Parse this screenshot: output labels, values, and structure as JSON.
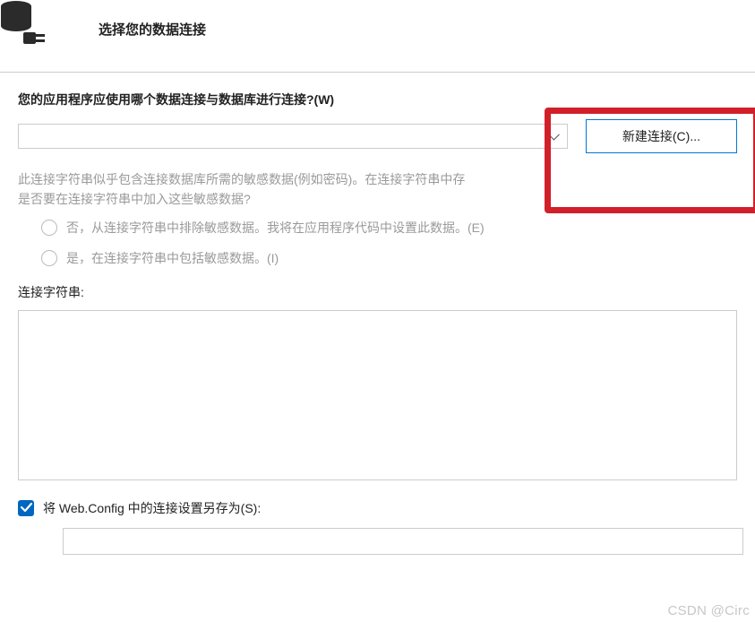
{
  "header": {
    "title": "选择您的数据连接"
  },
  "connection": {
    "question_label": "您的应用程序应使用哪个数据连接与数据库进行连接?(W)",
    "selected_value": "",
    "new_button_label": "新建连接(C)..."
  },
  "sensitive": {
    "info_line1": "此连接字符串似乎包含连接数据库所需的敏感数据(例如密码)。在连接字符串中存",
    "info_line2": "是否要在连接字符串中加入这些敏感数据?",
    "option_no": "否，从连接字符串中排除敏感数据。我将在应用程序代码中设置此数据。(E)",
    "option_yes": "是，在连接字符串中包括敏感数据。(I)"
  },
  "conn_string": {
    "label": "连接字符串:",
    "value": ""
  },
  "save_config": {
    "checkbox_label": "将 Web.Config 中的连接设置另存为(S):",
    "checked": true,
    "name_value": ""
  },
  "watermark": "CSDN @Circ"
}
